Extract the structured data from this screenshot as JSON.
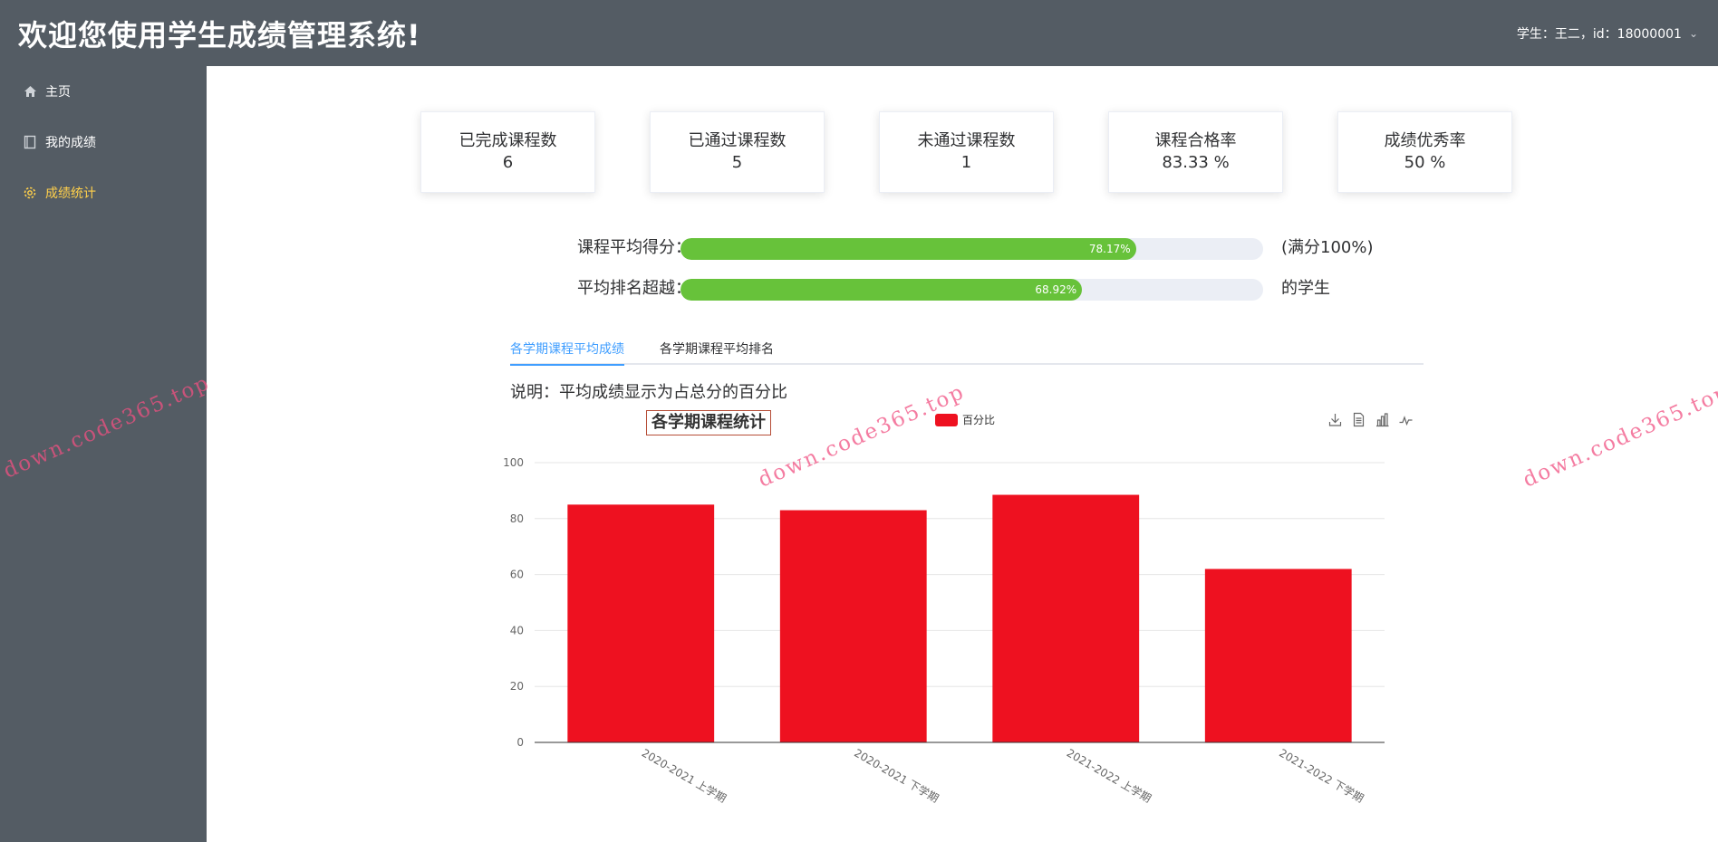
{
  "header": {
    "title": "欢迎您使用学生成绩管理系统!",
    "user_info": "学生：王二，id：18000001"
  },
  "sidebar": {
    "items": [
      {
        "label": "主页",
        "icon": "home-icon"
      },
      {
        "label": "我的成绩",
        "icon": "book-icon"
      },
      {
        "label": "成绩统计",
        "icon": "gear-icon",
        "active": true
      }
    ]
  },
  "colors": {
    "sidebar_bg": "#545c64",
    "active_menu": "#ffd04b",
    "progress": "#67c23a",
    "bar": "#ee1120",
    "tab_active": "#409eff"
  },
  "stats": [
    {
      "label": "已完成课程数",
      "value": "6"
    },
    {
      "label": "已通过课程数",
      "value": "5"
    },
    {
      "label": "未通过课程数",
      "value": "1"
    },
    {
      "label": "课程合格率",
      "value": "83.33 %"
    },
    {
      "label": "成绩优秀率",
      "value": "50 %"
    }
  ],
  "progress": [
    {
      "label": "课程平均得分：",
      "percent": 78.17,
      "text": "78.17%",
      "suffix": "(满分100%)"
    },
    {
      "label": "平均排名超越：",
      "percent": 68.92,
      "text": "68.92%",
      "suffix": "的学生"
    }
  ],
  "tabs": [
    {
      "label": "各学期课程平均成绩",
      "active": true
    },
    {
      "label": "各学期课程平均排名",
      "active": false
    }
  ],
  "note": "说明：平均成绩显示为占总分的百分比",
  "watermark": "down.code365.top",
  "chart_data": {
    "type": "bar",
    "title": "各学期课程统计",
    "categories": [
      "2020-2021 上学期",
      "2020-2021 下学期",
      "2021-2022 上学期",
      "2021-2022 下学期"
    ],
    "series": [
      {
        "name": "百分比",
        "values": [
          85,
          83,
          88.5,
          62
        ]
      }
    ],
    "ylim": [
      0,
      100
    ],
    "yticks": [
      0,
      20,
      40,
      60,
      80,
      100
    ],
    "grid": true,
    "legend": "top-center",
    "toolbox": [
      "download-icon",
      "data-view-icon",
      "bar-chart-icon",
      "line-chart-icon"
    ]
  }
}
